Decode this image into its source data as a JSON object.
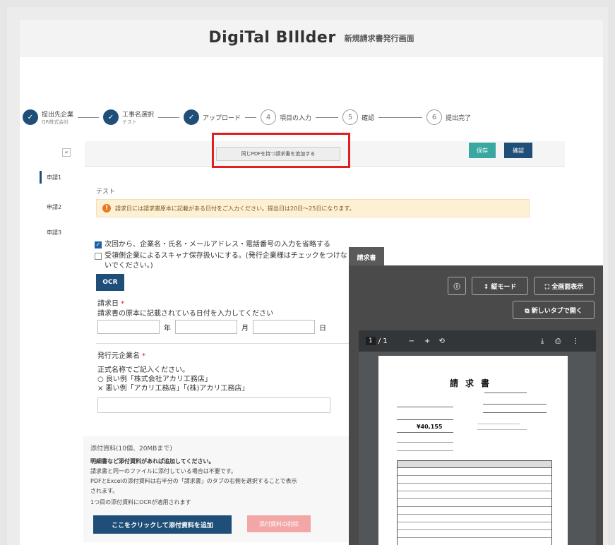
{
  "header": {
    "logo": "DigiTal BIllder",
    "subtitle": "新規請求書発行画面"
  },
  "stepper": [
    {
      "num": "",
      "label": "提出先企業",
      "sub": "QR株式会社",
      "done": true
    },
    {
      "num": "",
      "label": "工事名選択",
      "sub": "テスト",
      "done": true
    },
    {
      "num": "",
      "label": "アップロード",
      "sub": "",
      "done": true
    },
    {
      "num": "4",
      "label": "項目の入力",
      "sub": "",
      "done": false
    },
    {
      "num": "5",
      "label": "確認",
      "sub": "",
      "done": false
    },
    {
      "num": "6",
      "label": "提出完了",
      "sub": "",
      "done": false
    }
  ],
  "left_nav": {
    "collapse": "«",
    "items": [
      "申請1",
      "申請2",
      "申請3"
    ]
  },
  "toolbar": {
    "duplicate_label": "同じPDFを持つ請求書を追加する",
    "save_label": "保存",
    "confirm_label": "確認"
  },
  "form": {
    "name": "テスト",
    "alert_icon": "!",
    "alert_text": "請求日には請求書原本に記載がある日付をご入力ください。提出日は20日〜25日になります。",
    "check1": "次回から、企業名・氏名・メールアドレス・電話番号の入力を省略する",
    "check2": "受領側企業によるスキャナ保存扱いにする。(発行企業様はチェックをつけないでください。)",
    "ocr_label": "OCR",
    "date_label": "請求日",
    "date_desc": "請求書の原本に記載されている日付を入力してください",
    "year_unit": "年",
    "month_unit": "月",
    "day_unit": "日",
    "company_label": "発行元企業名",
    "company_desc1": "正式名称でご記入ください。",
    "company_desc2": "○ 良い例「株式会社アカリ工務店」",
    "company_desc3": "× 悪い例「アカリ工務店」「(株)アカリ工務店」"
  },
  "attachments": {
    "title": "添付資料(10個、20MBまで)",
    "line1": "明細書など添付資料があれば追加してください。",
    "line2": "請求書と同一のファイルに添付している場合は不要です。",
    "line3": "PDFとExcelの添付資料は右半分の「請求書」のタブの右側を選択することで表示",
    "line4": "されます。",
    "line5": "1つ目の添付資料にOCRが適用されます",
    "add_label": "ここをクリックして添付資料を追加",
    "delete_label": "添付資料の削除"
  },
  "viewer": {
    "tab": "請求書",
    "info_icon": "ⓘ",
    "mode_label": "↕ 縦モード",
    "fullscreen_label": "⛶ 全画面表示",
    "newtab_label": "⧉ 新しいタブで開く",
    "page_current": "1",
    "page_total": "/ 1",
    "zoom_out": "−",
    "zoom_in": "+",
    "rotate_icon": "⟲",
    "download_icon": "⤓",
    "print_icon": "⎙",
    "more_icon": "⋮",
    "doc_title": "請求書",
    "doc_amount": "¥40,155"
  }
}
